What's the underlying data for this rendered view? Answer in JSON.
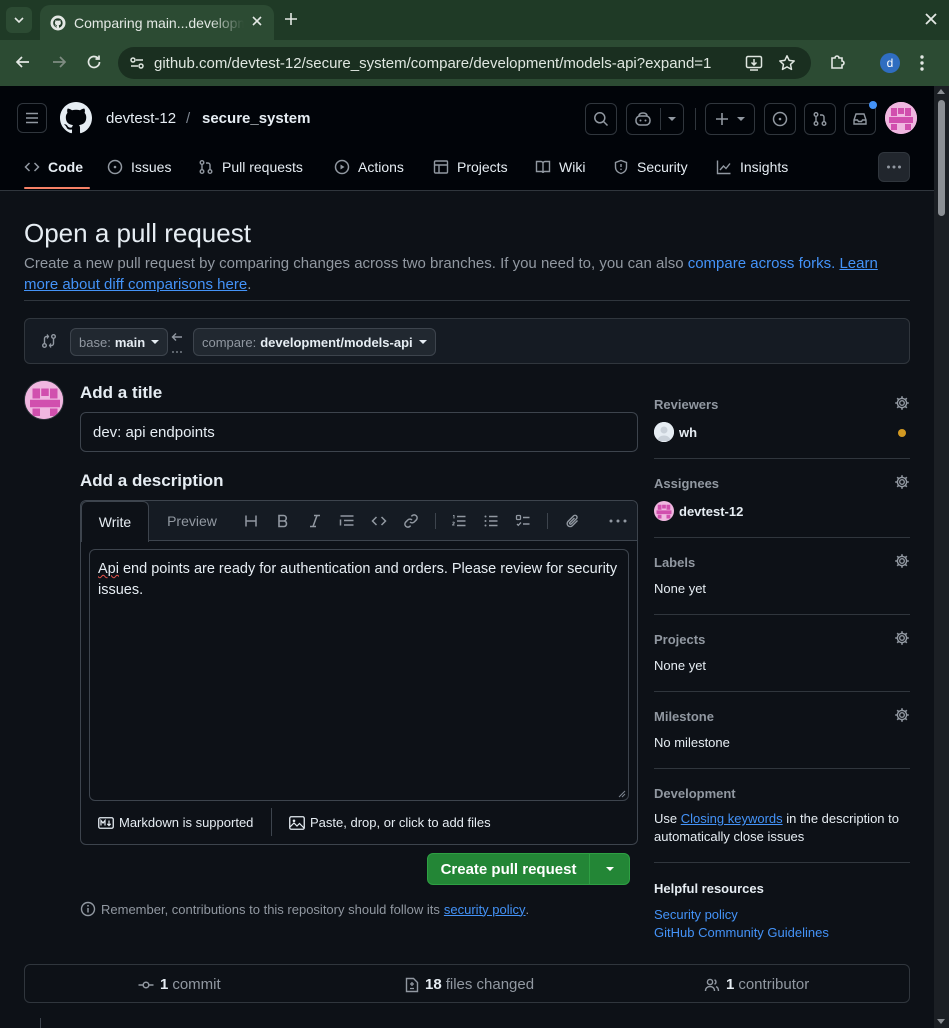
{
  "browser": {
    "tab_title": "Comparing main...development/models-api",
    "url": "github.com/devtest-12/secure_system/compare/development/models-api?expand=1",
    "profile_initial": "d"
  },
  "header": {
    "owner": "devtest-12",
    "separator": "/",
    "repo": "secure_system"
  },
  "repo_nav": {
    "items": [
      {
        "label": "Code",
        "icon": "code-icon"
      },
      {
        "label": "Issues",
        "icon": "issue-opened-icon"
      },
      {
        "label": "Pull requests",
        "icon": "git-pull-request-icon"
      },
      {
        "label": "Actions",
        "icon": "play-icon"
      },
      {
        "label": "Projects",
        "icon": "table-icon"
      },
      {
        "label": "Wiki",
        "icon": "book-icon"
      },
      {
        "label": "Security",
        "icon": "shield-icon"
      },
      {
        "label": "Insights",
        "icon": "graph-icon"
      }
    ]
  },
  "page": {
    "title": "Open a pull request",
    "subtitle_text": "Create a new pull request by comparing changes across two branches. If you need to, you can also",
    "subtitle_link1": "compare across forks.",
    "subtitle_link2": "Learn more about diff comparisons here",
    "subtitle_end": "."
  },
  "range": {
    "base_prefix": "base:",
    "base_branch": "main",
    "compare_prefix": "compare:",
    "compare_branch": "development/models-api"
  },
  "form": {
    "title_label": "Add a title",
    "title_value": "dev: api endpoints",
    "description_label": "Add a description",
    "tab_write": "Write",
    "tab_preview": "Preview",
    "description_first_word": "Api",
    "description_rest": " end points are ready for authentication and orders. Please review for security issues.",
    "markdown_note": "Markdown is supported",
    "attach_note": "Paste, drop, or click to add files",
    "submit_label": "Create pull request",
    "remember_text": "Remember, contributions to this repository should follow its",
    "remember_link": "security policy",
    "remember_end": "."
  },
  "sidebar": {
    "reviewers": {
      "label": "Reviewers",
      "value": "wh",
      "status_color": "#d29922"
    },
    "assignees": {
      "label": "Assignees",
      "value": "devtest-12"
    },
    "labels": {
      "label": "Labels",
      "value": "None yet"
    },
    "projects": {
      "label": "Projects",
      "value": "None yet"
    },
    "milestone": {
      "label": "Milestone",
      "value": "No milestone"
    },
    "development": {
      "label": "Development",
      "text_before": "Use",
      "link": "Closing keywords",
      "text_after": "in the description to automatically close issues"
    },
    "helpful": {
      "label": "Helpful resources",
      "links": [
        "Security policy",
        "GitHub Community Guidelines"
      ]
    }
  },
  "stats": {
    "commits_count": "1",
    "commits_label": "commit",
    "files_count": "18",
    "files_label": "files changed",
    "contributors_count": "1",
    "contributors_label": "contributor"
  },
  "colors": {
    "accent_link": "#4493f8",
    "primary_button": "#238636",
    "tab_underline": "#f78166",
    "chrome_green": "#2c4b33"
  }
}
